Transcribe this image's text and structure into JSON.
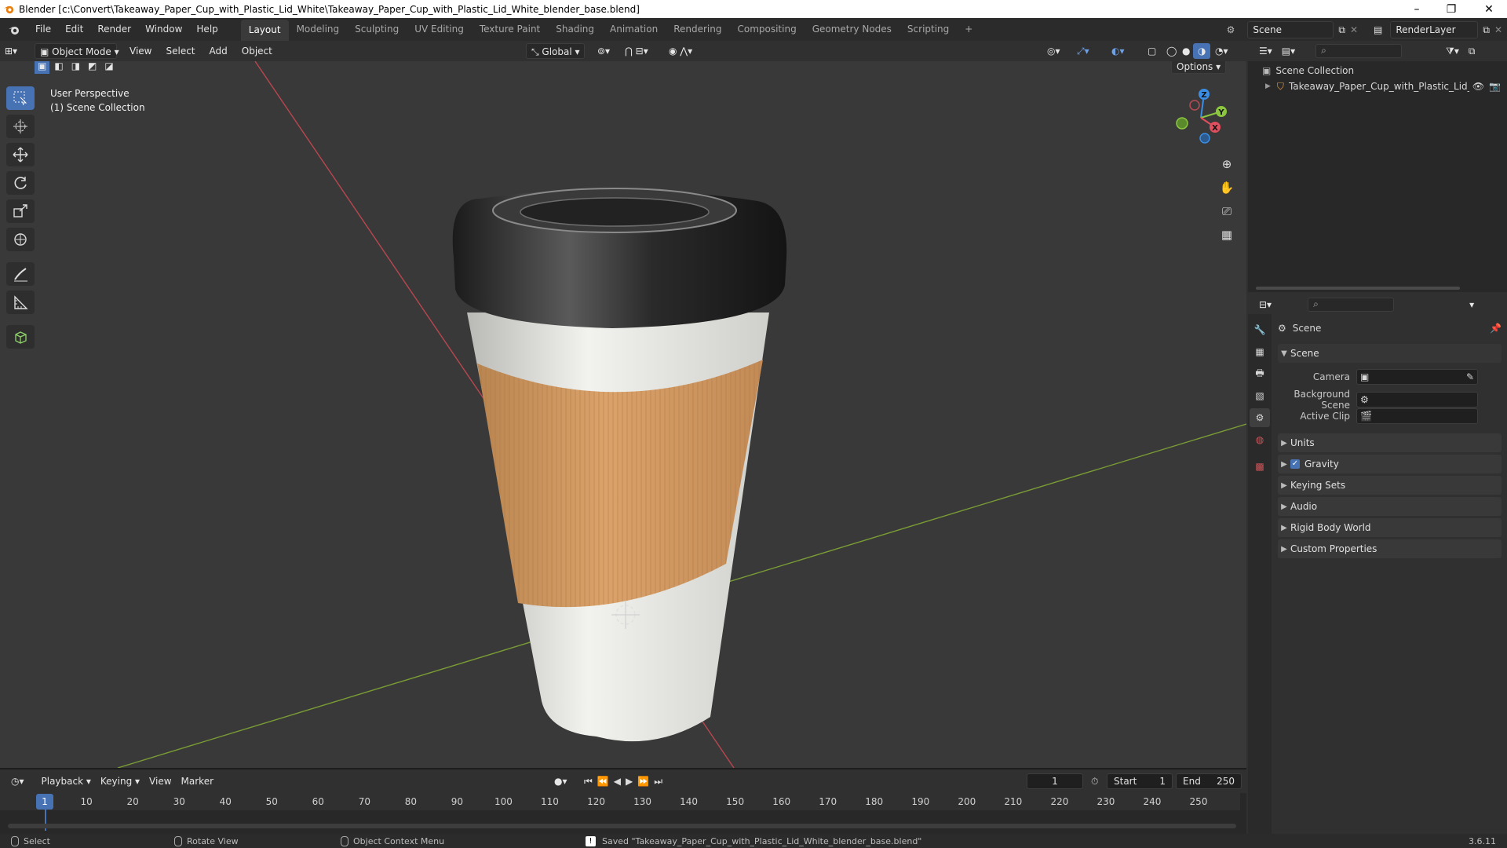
{
  "window": {
    "title": "Blender [c:\\Convert\\Takeaway_Paper_Cup_with_Plastic_Lid_White\\Takeaway_Paper_Cup_with_Plastic_Lid_White_blender_base.blend]",
    "minimize": "–",
    "maximize": "❐",
    "close": "✕"
  },
  "menu": [
    "File",
    "Edit",
    "Render",
    "Window",
    "Help"
  ],
  "workspaces": [
    "Layout",
    "Modeling",
    "Sculpting",
    "UV Editing",
    "Texture Paint",
    "Shading",
    "Animation",
    "Rendering",
    "Compositing",
    "Geometry Nodes",
    "Scripting"
  ],
  "workspace_add": "+",
  "active_workspace": "Layout",
  "scene_selector": "Scene",
  "render_layer": "RenderLayer",
  "viewport_header": {
    "mode": "Object Mode",
    "menus": [
      "View",
      "Select",
      "Add",
      "Object"
    ],
    "orientation": "Global",
    "options": "Options"
  },
  "viewport": {
    "perspective": "User Perspective",
    "collection": "(1) Scene Collection",
    "axis_x": "X",
    "axis_y": "Y",
    "axis_z": "Z"
  },
  "outliner": {
    "root": "Scene Collection",
    "item": "Takeaway_Paper_Cup_with_Plastic_Lid_"
  },
  "properties": {
    "context": "Scene",
    "section": "Scene",
    "camera_label": "Camera",
    "background_label": "Background Scene",
    "clip_label": "Active Clip",
    "panels": [
      "Units",
      "Gravity",
      "Keying Sets",
      "Audio",
      "Rigid Body World",
      "Custom Properties"
    ],
    "gravity_checked": true
  },
  "timeline": {
    "menus": [
      "Playback",
      "Keying",
      "View",
      "Marker"
    ],
    "current_frame": "1",
    "start_label": "Start",
    "start": "1",
    "end_label": "End",
    "end": "250",
    "ticks": [
      "1",
      "10",
      "20",
      "30",
      "40",
      "50",
      "60",
      "70",
      "80",
      "90",
      "100",
      "110",
      "120",
      "130",
      "140",
      "150",
      "160",
      "170",
      "180",
      "190",
      "200",
      "210",
      "220",
      "230",
      "240",
      "250"
    ]
  },
  "status": {
    "select": "Select",
    "rotate": "Rotate View",
    "context_menu": "Object Context Menu",
    "message": "Saved \"Takeaway_Paper_Cup_with_Plastic_Lid_White_blender_base.blend\"",
    "version": "3.6.11"
  },
  "colors": {
    "accent": "#4772b3",
    "axis_x": "#e04f5f",
    "axis_y": "#8cc63f",
    "axis_z": "#3b8ee6"
  }
}
